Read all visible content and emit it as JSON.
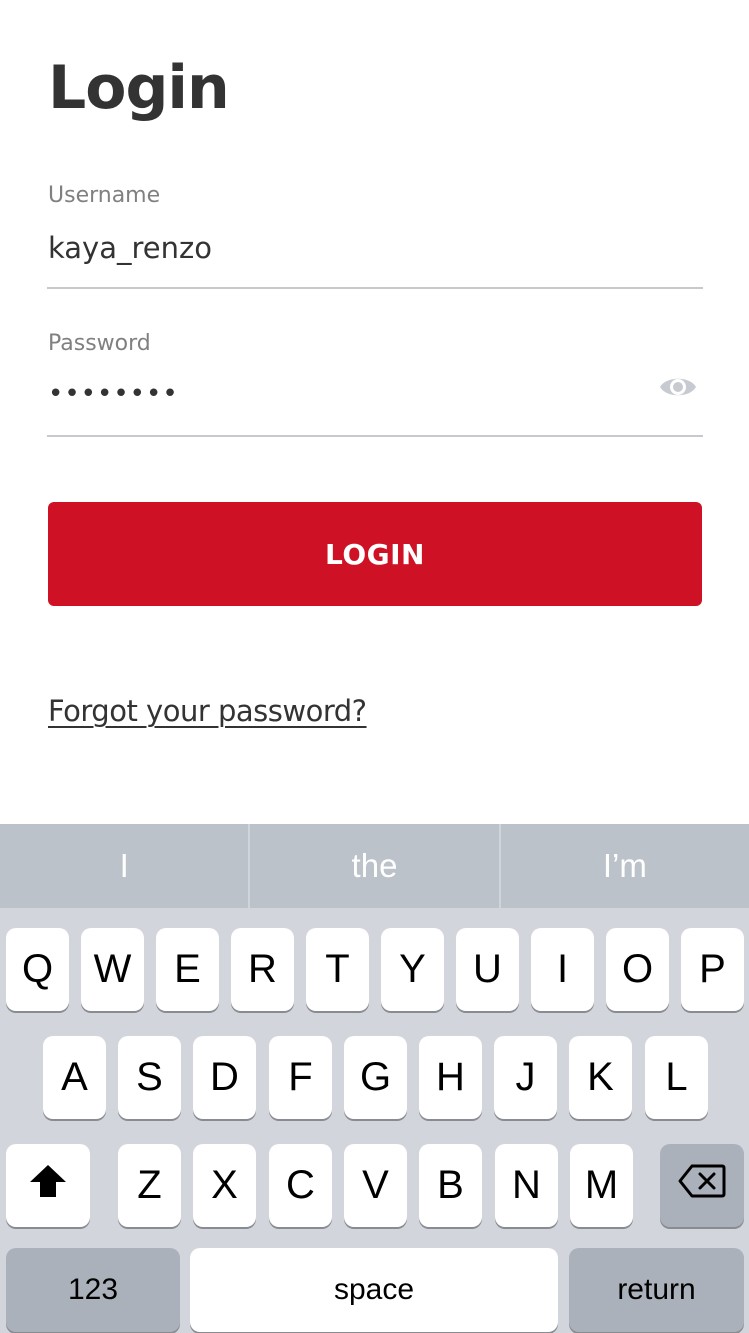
{
  "page": {
    "title": "Login"
  },
  "form": {
    "username": {
      "label": "Username",
      "value": "kaya_renzo"
    },
    "password": {
      "label": "Password",
      "value": "••••••••",
      "toggle_icon": "eye-icon"
    },
    "login_button": "LOGIN",
    "forgot_link": "Forgot your password?"
  },
  "colors": {
    "accent": "#cf1126",
    "text": "#333333",
    "label": "#808080",
    "underline": "#c8c8cd",
    "keyboard_bg": "#d2d5db",
    "suggestion_bg": "#bbc2ca"
  },
  "keyboard": {
    "suggestions": [
      "I",
      "the",
      "I’m"
    ],
    "row1": [
      "Q",
      "W",
      "E",
      "R",
      "T",
      "Y",
      "U",
      "I",
      "O",
      "P"
    ],
    "row2": [
      "A",
      "S",
      "D",
      "F",
      "G",
      "H",
      "J",
      "K",
      "L"
    ],
    "row3": [
      "Z",
      "X",
      "C",
      "V",
      "B",
      "N",
      "M"
    ],
    "shift_icon": "shift-icon",
    "backspace_icon": "backspace-icon",
    "numbers_label": "123",
    "space_label": "space",
    "return_label": "return"
  }
}
